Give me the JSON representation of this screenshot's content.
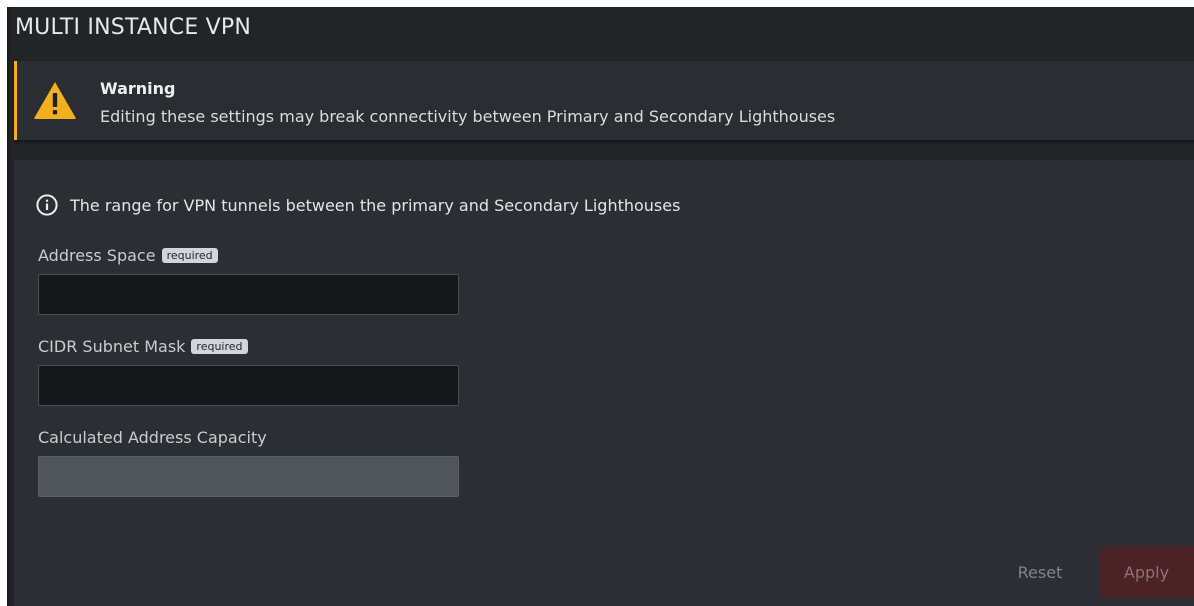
{
  "page": {
    "title": "MULTI INSTANCE VPN"
  },
  "warning": {
    "title": "Warning",
    "message": "Editing these settings may break connectivity between Primary and Secondary Lighthouses",
    "accent_color": "#f2b01e"
  },
  "form": {
    "info_text": "The range for VPN tunnels between the primary and Secondary Lighthouses",
    "fields": [
      {
        "label": "Address Space",
        "badge": "required",
        "value": "",
        "readonly": false
      },
      {
        "label": "CIDR Subnet Mask",
        "badge": "required",
        "value": "",
        "readonly": false
      },
      {
        "label": "Calculated Address Capacity",
        "value": "",
        "readonly": true
      }
    ]
  },
  "actions": {
    "reset_label": "Reset",
    "apply_label": "Apply"
  },
  "colors": {
    "background": "#222528",
    "panel": "#2b2e32",
    "apply_disabled": "#4b2226"
  }
}
